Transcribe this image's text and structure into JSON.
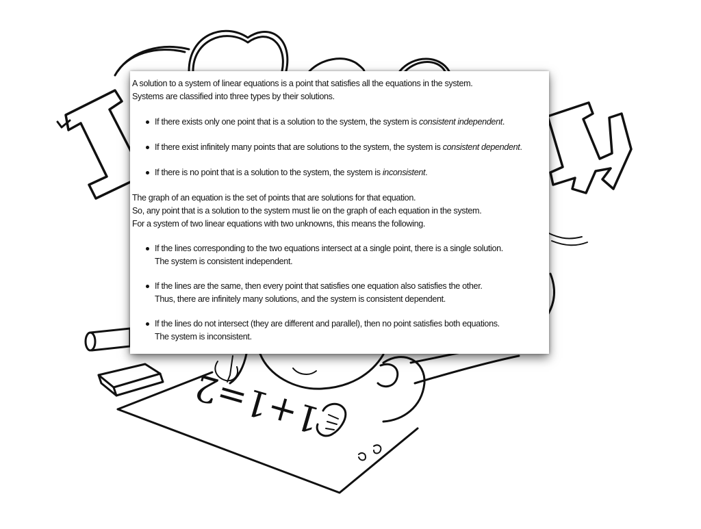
{
  "intro": {
    "line1": "A solution to a system of linear equations is a point that satisfies all the equations in the system.",
    "line2": "Systems are classified into three types by their solutions."
  },
  "types": [
    {
      "text": "If there exists only one point that is a solution to the system, the system is ",
      "term": "consistent independent",
      "end": "."
    },
    {
      "text": "If there exist infinitely many points that are solutions to the system, the system is ",
      "term": "consistent dependent",
      "end": "."
    },
    {
      "text": "If there is no point that is a solution to the system, the system is ",
      "term": "inconsistent",
      "end": "."
    }
  ],
  "graph": {
    "line1": "The graph of an equation is the set of points that are solutions for that equation.",
    "line2": "So, any point that is a solution to the system must lie on the graph of each equation in the system.",
    "line3": "For a system of two linear equations with two unknowns, this means the following."
  },
  "cases": [
    {
      "line1": "If the lines corresponding to the two equations intersect at a single point, there is a single solution.",
      "line2": "The system is consistent independent."
    },
    {
      "line1": "If the lines are the same, then every point that satisfies one equation also satisfies the other.",
      "line2": "Thus, there are infinitely many solutions, and the system is consistent dependent."
    },
    {
      "line1": "If the lines do not intersect (they are different and parallel), then no point satisfies both equations.",
      "line2": "The system is inconsistent."
    }
  ],
  "illustration": {
    "banner_visible": [
      "I",
      "H"
    ],
    "paper_equation": "1+1=2",
    "colors": {
      "ink": "#111111",
      "paper": "#ffffff"
    }
  }
}
